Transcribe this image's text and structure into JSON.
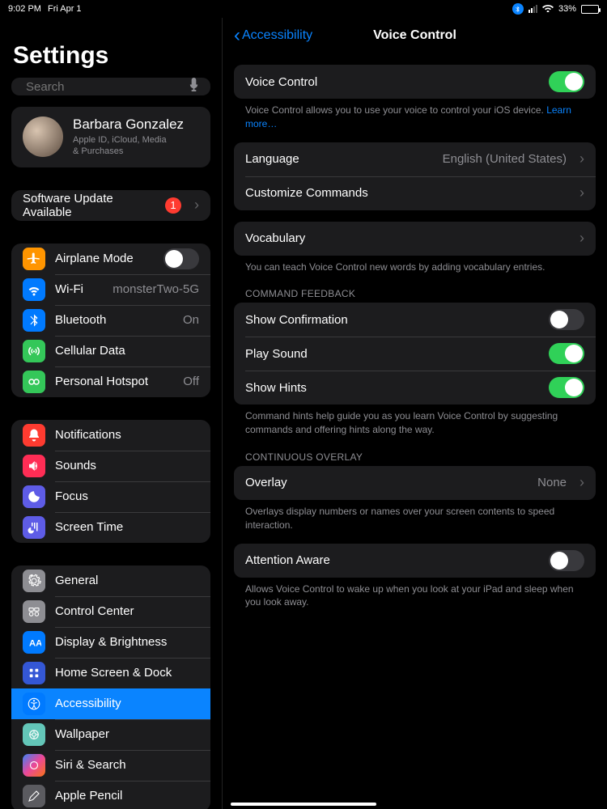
{
  "status": {
    "time": "9:02 PM",
    "date": "Fri Apr 1",
    "battery": "33%"
  },
  "sidebar": {
    "title": "Settings",
    "search_placeholder": "Search",
    "profile": {
      "name": "Barbara Gonzalez",
      "sub": "Apple ID, iCloud, Media\n& Purchases"
    },
    "update": {
      "label": "Software Update Available",
      "badge": "1"
    },
    "g1": {
      "airplane": "Airplane Mode",
      "wifi": "Wi-Fi",
      "wifi_value": "monsterTwo-5G",
      "bluetooth": "Bluetooth",
      "bluetooth_value": "On",
      "cellular": "Cellular Data",
      "hotspot": "Personal Hotspot",
      "hotspot_value": "Off"
    },
    "g2": {
      "notifications": "Notifications",
      "sounds": "Sounds",
      "focus": "Focus",
      "screentime": "Screen Time"
    },
    "g3": {
      "general": "General",
      "control": "Control Center",
      "display": "Display & Brightness",
      "home": "Home Screen & Dock",
      "accessibility": "Accessibility",
      "wallpaper": "Wallpaper",
      "siri": "Siri & Search",
      "pencil": "Apple Pencil"
    }
  },
  "detail": {
    "back": "Accessibility",
    "title": "Voice Control",
    "voice_control": {
      "label": "Voice Control",
      "on": true,
      "footer": "Voice Control allows you to use your voice to control your iOS device. ",
      "learn_more": "Learn more…"
    },
    "language": {
      "label": "Language",
      "value": "English (United States)"
    },
    "customize": {
      "label": "Customize Commands"
    },
    "vocab": {
      "label": "Vocabulary",
      "footer": "You can teach Voice Control new words by adding vocabulary entries."
    },
    "feedback_header": "COMMAND FEEDBACK",
    "show_confirmation": {
      "label": "Show Confirmation",
      "on": false
    },
    "play_sound": {
      "label": "Play Sound",
      "on": true
    },
    "show_hints": {
      "label": "Show Hints",
      "on": true,
      "footer": "Command hints help guide you as you learn Voice Control by suggesting commands and offering hints along the way."
    },
    "overlay_header": "CONTINUOUS OVERLAY",
    "overlay": {
      "label": "Overlay",
      "value": "None",
      "footer": "Overlays display numbers or names over your screen contents to speed interaction."
    },
    "attention": {
      "label": "Attention Aware",
      "on": false,
      "footer": "Allows Voice Control to wake up when you look at your iPad and sleep when you look away."
    }
  }
}
